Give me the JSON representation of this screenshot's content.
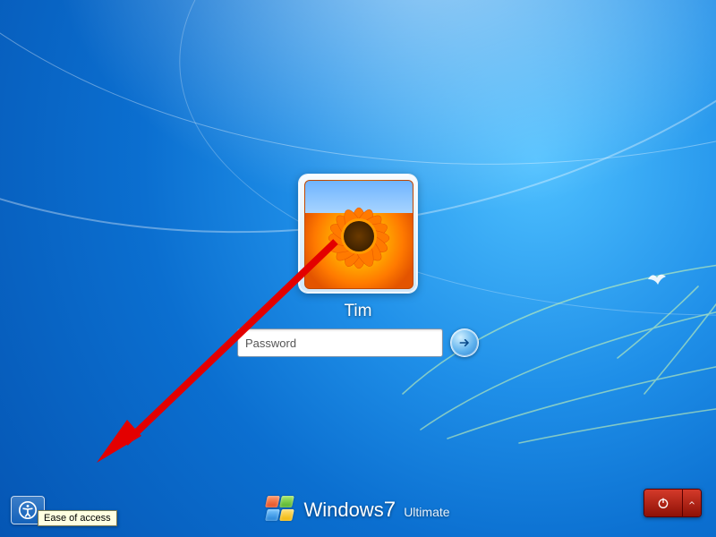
{
  "user": {
    "name": "Tim"
  },
  "password": {
    "placeholder": "Password"
  },
  "ease_of_access": {
    "tooltip": "Ease of access"
  },
  "branding": {
    "product": "Windows",
    "version": "7",
    "edition": "Ultimate"
  },
  "icons": {
    "submit": "arrow-right-icon",
    "ease": "accessibility-icon",
    "power": "power-icon",
    "power_menu": "chevron-up-icon"
  }
}
